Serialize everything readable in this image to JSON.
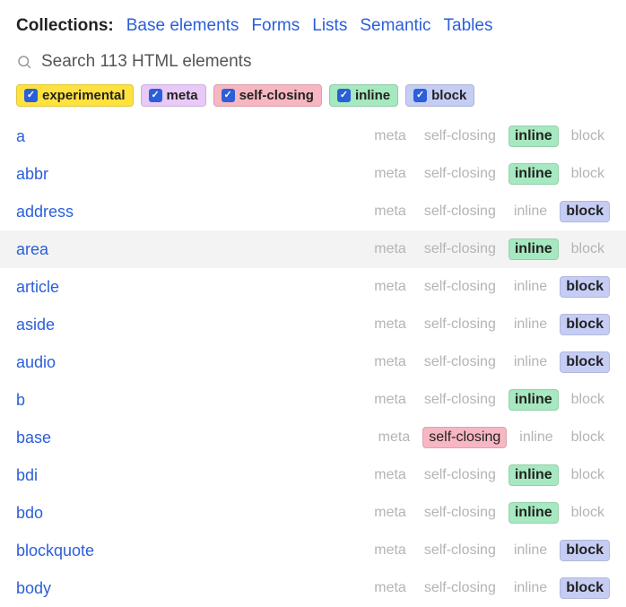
{
  "header": {
    "label": "Collections:",
    "links": [
      "Base elements",
      "Forms",
      "Lists",
      "Semantic",
      "Tables"
    ]
  },
  "search": {
    "placeholder": "Search 113 HTML elements"
  },
  "filters": [
    {
      "key": "experimental",
      "label": "experimental",
      "checked": true
    },
    {
      "key": "meta",
      "label": "meta",
      "checked": true
    },
    {
      "key": "selfclosing",
      "label": "self-closing",
      "checked": true
    },
    {
      "key": "inline",
      "label": "inline",
      "checked": true
    },
    {
      "key": "block",
      "label": "block",
      "checked": true
    }
  ],
  "tag_labels": {
    "meta": "meta",
    "selfclosing": "self-closing",
    "inline": "inline",
    "block": "block"
  },
  "elements": [
    {
      "name": "a",
      "active": [
        "inline"
      ],
      "hover": false
    },
    {
      "name": "abbr",
      "active": [
        "inline"
      ],
      "hover": false
    },
    {
      "name": "address",
      "active": [
        "block"
      ],
      "hover": false
    },
    {
      "name": "area",
      "active": [
        "inline"
      ],
      "hover": true
    },
    {
      "name": "article",
      "active": [
        "block"
      ],
      "hover": false
    },
    {
      "name": "aside",
      "active": [
        "block"
      ],
      "hover": false
    },
    {
      "name": "audio",
      "active": [
        "block"
      ],
      "hover": false
    },
    {
      "name": "b",
      "active": [
        "inline"
      ],
      "hover": false
    },
    {
      "name": "base",
      "active": [
        "selfclosing"
      ],
      "hover": false
    },
    {
      "name": "bdi",
      "active": [
        "inline"
      ],
      "hover": false
    },
    {
      "name": "bdo",
      "active": [
        "inline"
      ],
      "hover": false
    },
    {
      "name": "blockquote",
      "active": [
        "block"
      ],
      "hover": false
    },
    {
      "name": "body",
      "active": [
        "block"
      ],
      "hover": false
    }
  ]
}
